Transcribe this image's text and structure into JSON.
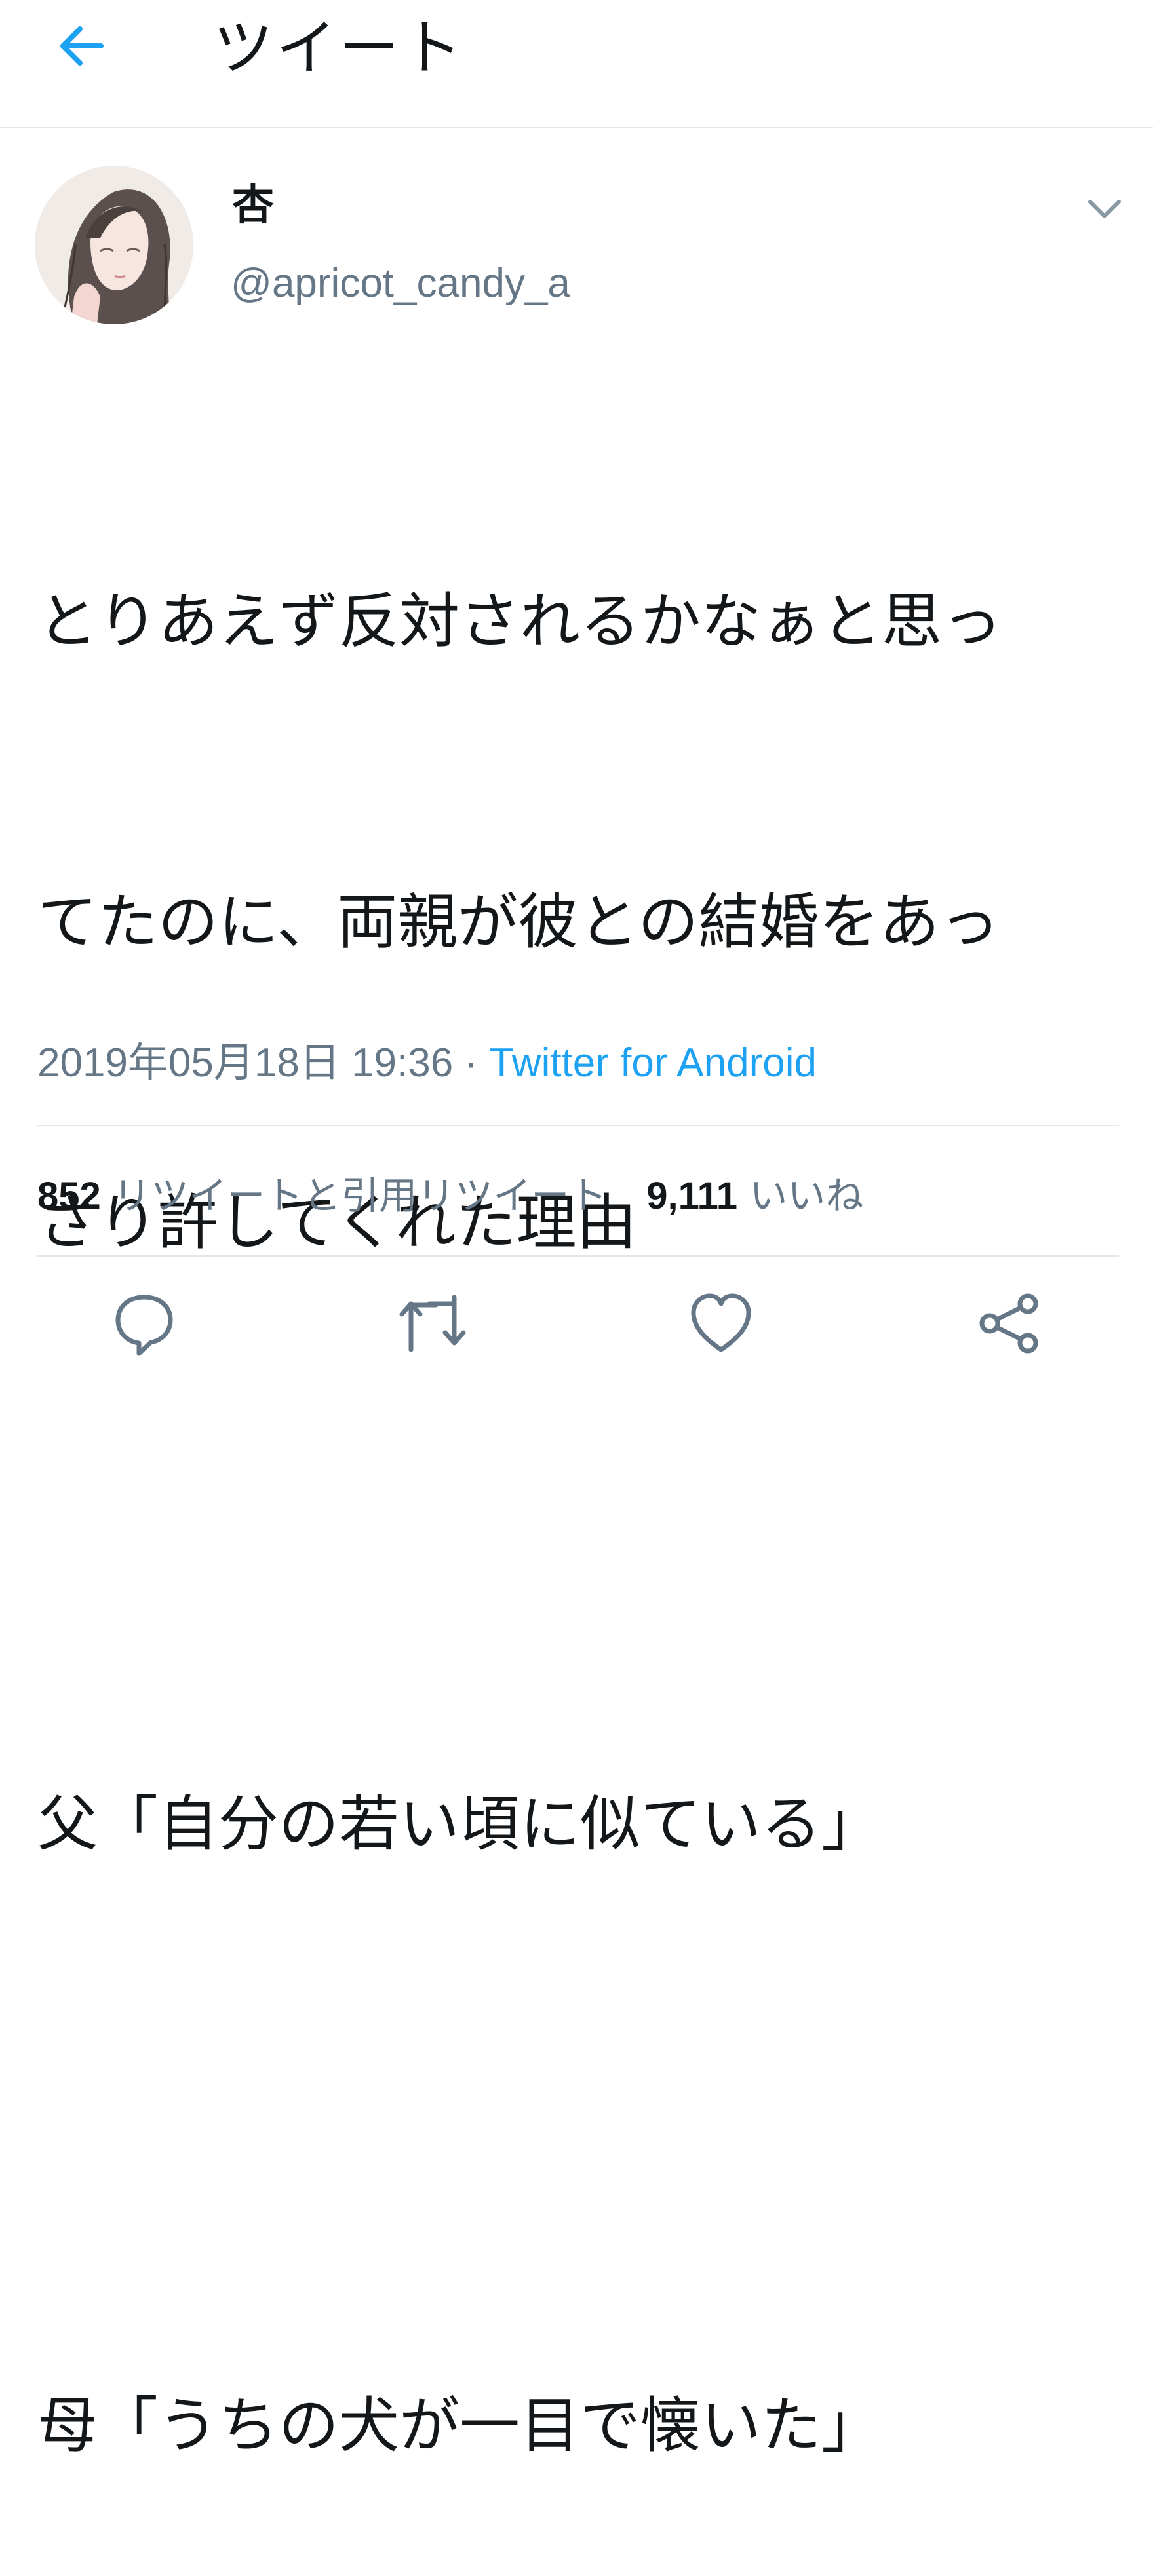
{
  "header": {
    "title": "ツイート"
  },
  "accent_color": "#1da1f2",
  "user": {
    "display_name": "杏",
    "handle": "@apricot_candy_a"
  },
  "tweet": {
    "lines": [
      "とりあえず反対されるかなぁと思っ",
      "てたのに、両親が彼との結婚をあっ",
      "さり許してくれた理由",
      "",
      "父「自分の若い頃に似ている」",
      "",
      "母「うちの犬が一目で懐いた」"
    ],
    "timestamp": "2019年05月18日 19:36",
    "separator": " · ",
    "source": "Twitter for Android"
  },
  "stats": {
    "retweets_count": "852",
    "retweets_label": "リツイートと引用リツイート",
    "likes_count": "9,111",
    "likes_label": "いいね"
  },
  "icons": {
    "back": "arrow-left-icon",
    "caret": "chevron-down-icon",
    "reply": "reply-icon",
    "retweet": "retweet-icon",
    "like": "heart-icon",
    "share": "share-icon"
  }
}
